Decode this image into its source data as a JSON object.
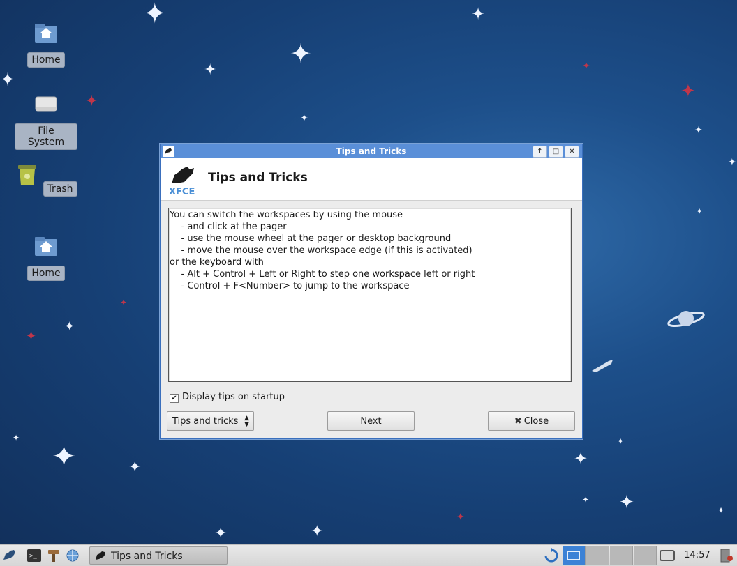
{
  "desktop": {
    "icons": [
      {
        "label": "Home",
        "icon": "home-folder-icon"
      },
      {
        "label": "File System",
        "icon": "drive-icon"
      },
      {
        "label": "Trash",
        "icon": "trash-icon"
      },
      {
        "label": "Home",
        "icon": "home-folder-icon"
      }
    ]
  },
  "dialog": {
    "window_title": "Tips and Tricks",
    "header_title": "Tips and Tricks",
    "tip_lines": [
      "You can switch the workspaces by using the mouse",
      "    - and click at the pager",
      "    - use the mouse wheel at the pager or desktop background",
      "    - move the mouse over the workspace edge (if this is activated)",
      "or the keyboard with",
      "    - Alt + Control + Left or Right to step one workspace left or right",
      "    - Control + F<Number> to jump to the workspace"
    ],
    "display_tips_label": "Display tips on startup",
    "display_tips_checked": true,
    "category_select": "Tips and tricks",
    "next_label": "Next",
    "close_label": "Close"
  },
  "taskbar": {
    "task_label": "Tips and Tricks",
    "clock": "14:57",
    "active_workspace": 1,
    "workspace_count": 4
  },
  "colors": {
    "title_bar": "#5a8fd8",
    "desktop_bg": "#1d4f8a",
    "active_workspace": "#3c82d6"
  }
}
